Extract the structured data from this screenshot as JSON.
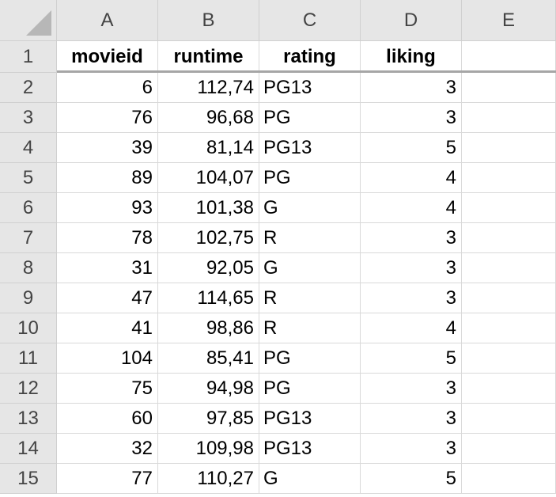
{
  "columns": [
    "A",
    "B",
    "C",
    "D",
    "E"
  ],
  "row_numbers": [
    "1",
    "2",
    "3",
    "4",
    "5",
    "6",
    "7",
    "8",
    "9",
    "10",
    "11",
    "12",
    "13",
    "14",
    "15"
  ],
  "header_row": {
    "movieid": "movieid",
    "runtime": "runtime",
    "rating": "rating",
    "liking": "liking",
    "e": ""
  },
  "rows": [
    {
      "movieid": "6",
      "runtime": "112,74",
      "rating": "PG13",
      "liking": "3"
    },
    {
      "movieid": "76",
      "runtime": "96,68",
      "rating": "PG",
      "liking": "3"
    },
    {
      "movieid": "39",
      "runtime": "81,14",
      "rating": "PG13",
      "liking": "5"
    },
    {
      "movieid": "89",
      "runtime": "104,07",
      "rating": "PG",
      "liking": "4"
    },
    {
      "movieid": "93",
      "runtime": "101,38",
      "rating": "G",
      "liking": "4"
    },
    {
      "movieid": "78",
      "runtime": "102,75",
      "rating": "R",
      "liking": "3"
    },
    {
      "movieid": "31",
      "runtime": "92,05",
      "rating": "G",
      "liking": "3"
    },
    {
      "movieid": "47",
      "runtime": "114,65",
      "rating": "R",
      "liking": "3"
    },
    {
      "movieid": "41",
      "runtime": "98,86",
      "rating": "R",
      "liking": "4"
    },
    {
      "movieid": "104",
      "runtime": "85,41",
      "rating": "PG",
      "liking": "5"
    },
    {
      "movieid": "75",
      "runtime": "94,98",
      "rating": "PG",
      "liking": "3"
    },
    {
      "movieid": "60",
      "runtime": "97,85",
      "rating": "PG13",
      "liking": "3"
    },
    {
      "movieid": "32",
      "runtime": "109,98",
      "rating": "PG13",
      "liking": "3"
    },
    {
      "movieid": "77",
      "runtime": "110,27",
      "rating": "G",
      "liking": "5"
    }
  ]
}
